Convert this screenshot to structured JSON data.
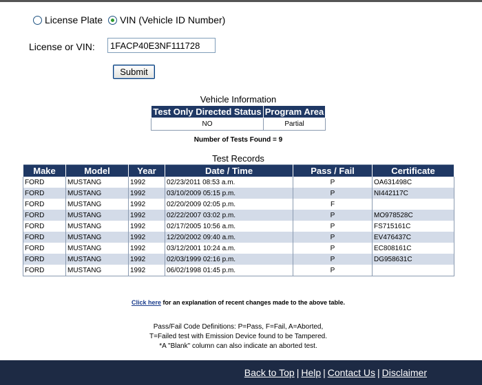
{
  "search": {
    "options": [
      {
        "label": "License Plate",
        "checked": false
      },
      {
        "label": "VIN (Vehicle ID Number)",
        "checked": true
      }
    ],
    "field_label": "License or VIN:",
    "field_value": "1FACP40E3NF111728",
    "submit_label": "Submit"
  },
  "vehicle_info": {
    "caption": "Vehicle Information",
    "headers": [
      "Test Only Directed Status",
      "Program Area"
    ],
    "values": [
      "NO",
      "Partial"
    ]
  },
  "num_tests": "Number of Tests Found = 9",
  "test_records": {
    "caption": "Test Records",
    "headers": [
      "Make",
      "Model",
      "Year",
      "Date / Time",
      "Pass / Fail",
      "Certificate"
    ],
    "rows": [
      [
        "FORD",
        "MUSTANG",
        "1992",
        "02/23/2011 08:53 a.m.",
        "P",
        "OA631498C"
      ],
      [
        "FORD",
        "MUSTANG",
        "1992",
        "03/10/2009 05:15 p.m.",
        "P",
        "NI442117C"
      ],
      [
        "FORD",
        "MUSTANG",
        "1992",
        "02/20/2009 02:05 p.m.",
        "F",
        ""
      ],
      [
        "FORD",
        "MUSTANG",
        "1992",
        "02/22/2007 03:02 p.m.",
        "P",
        "MO978528C"
      ],
      [
        "FORD",
        "MUSTANG",
        "1992",
        "02/17/2005 10:56 a.m.",
        "P",
        "FS715161C"
      ],
      [
        "FORD",
        "MUSTANG",
        "1992",
        "12/20/2002 09:40 a.m.",
        "P",
        "EV476437C"
      ],
      [
        "FORD",
        "MUSTANG",
        "1992",
        "03/12/2001 10:24 a.m.",
        "P",
        "EC808161C"
      ],
      [
        "FORD",
        "MUSTANG",
        "1992",
        "02/03/1999 02:16 p.m.",
        "P",
        "DG958631C"
      ],
      [
        "FORD",
        "MUSTANG",
        "1992",
        "06/02/1998 01:45 p.m.",
        "P",
        ""
      ]
    ]
  },
  "explain": {
    "link": "Click here",
    "text": " for an explanation of recent changes made to the above table."
  },
  "definitions": [
    "Pass/Fail Code Definitions: P=Pass, F=Fail, A=Aborted,",
    "T=Failed test with Emission Device found to be Tampered.",
    "*A \"Blank\" column can also indicate an aborted test."
  ],
  "footer": {
    "links": [
      "Back to Top",
      "Help",
      "Contact Us",
      "Disclaimer"
    ],
    "separator": "|"
  }
}
